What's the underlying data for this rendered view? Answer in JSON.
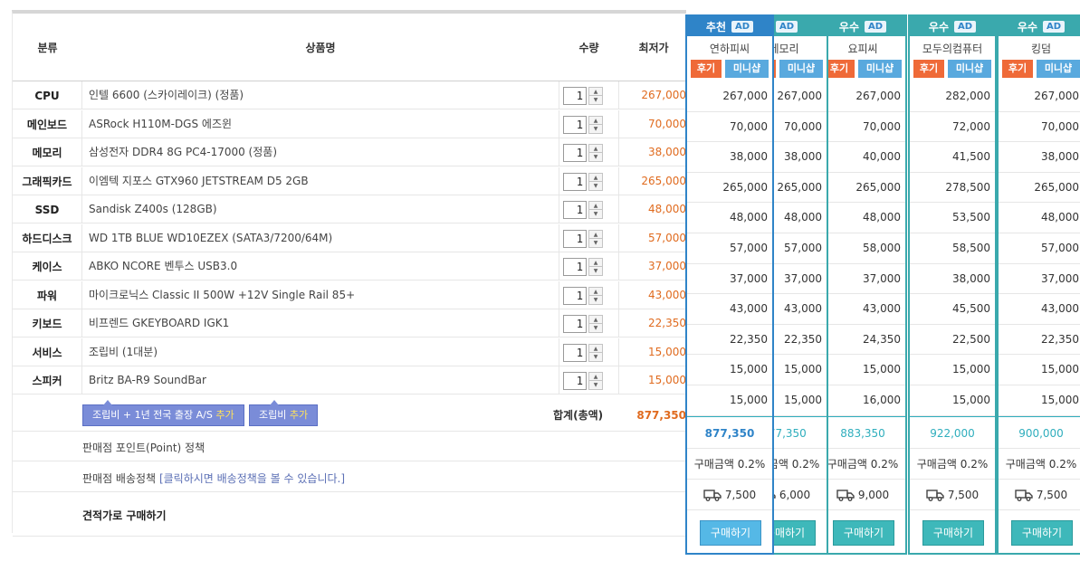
{
  "table": {
    "headers": {
      "category": "분류",
      "product": "상품명",
      "qty": "수량",
      "lowest": "최저가"
    },
    "rows": [
      {
        "category": "CPU",
        "product": "인텔 6600 (스카이레이크) (정품)",
        "qty": "1",
        "price": "267,000"
      },
      {
        "category": "메인보드",
        "product": "ASRock H110M-DGS 에즈윈",
        "qty": "1",
        "price": "70,000"
      },
      {
        "category": "메모리",
        "product": "삼성전자 DDR4 8G PC4-17000 (정품)",
        "qty": "1",
        "price": "38,000"
      },
      {
        "category": "그래픽카드",
        "product": "이엠텍 지포스 GTX960 JETSTREAM D5 2GB",
        "qty": "1",
        "price": "265,000"
      },
      {
        "category": "SSD",
        "product": "Sandisk Z400s (128GB)",
        "qty": "1",
        "price": "48,000"
      },
      {
        "category": "하드디스크",
        "product": "WD 1TB BLUE WD10EZEX (SATA3/7200/64M)",
        "qty": "1",
        "price": "57,000"
      },
      {
        "category": "케이스",
        "product": "ABKO NCORE 벤투스 USB3.0",
        "qty": "1",
        "price": "37,000"
      },
      {
        "category": "파워",
        "product": "마이크로닉스 Classic II 500W +12V Single Rail 85+",
        "qty": "1",
        "price": "43,000"
      },
      {
        "category": "키보드",
        "product": "비프렌드 GKEYBOARD IGK1",
        "qty": "1",
        "price": "22,350"
      },
      {
        "category": "서비스",
        "product": "조립비 (1대분)",
        "qty": "1",
        "price": "15,000"
      },
      {
        "category": "스피커",
        "product": "Britz BA-R9 SoundBar",
        "qty": "1",
        "price": "15,000"
      }
    ],
    "add_assembly_as": {
      "prefix": "조립비 + 1년 전국 출장 A/S ",
      "action": "추가"
    },
    "add_assembly": {
      "prefix": "조립비 ",
      "action": "추가"
    },
    "sum_label": "합계(총액)",
    "sum_value": "877,350",
    "point_policy": "판매점 포인트(Point) 정책",
    "shipping_policy": "판매점 배송정책",
    "shipping_policy_link": "[클릭하시면 배송정책을 볼 수 있습니다.]",
    "buy_at_estimate": "견적가로 구매하기"
  },
  "stores": [
    {
      "badge": "추천",
      "ad": "AD",
      "name": "연하피씨",
      "review": "후기",
      "minishop": "미니샵",
      "prices": [
        "267,000",
        "70,000",
        "38,000",
        "265,000",
        "48,000",
        "57,000",
        "37,000",
        "43,000",
        "22,350",
        "15,000",
        "15,000"
      ],
      "total": "877,350",
      "point": "구매금액 0.2%",
      "shipping": "7,500",
      "buy": "구매하기",
      "selected": true
    },
    {
      "badge": "",
      "ad": "AD",
      "name": "메모리",
      "review": "후기",
      "minishop": "미니샵",
      "prices": [
        "267,000",
        "70,000",
        "38,000",
        "265,000",
        "48,000",
        "57,000",
        "37,000",
        "43,000",
        "22,350",
        "15,000",
        "15,000"
      ],
      "total": "877,350",
      "point": "구매금액 0.2%",
      "shipping": "6,000",
      "buy": "구매하기",
      "selected": false
    },
    {
      "badge": "우수",
      "ad": "AD",
      "name": "요피씨",
      "review": "후기",
      "minishop": "미니샵",
      "prices": [
        "267,000",
        "70,000",
        "40,000",
        "265,000",
        "48,000",
        "58,000",
        "37,000",
        "43,000",
        "24,350",
        "15,000",
        "16,000"
      ],
      "total": "883,350",
      "point": "구매금액 0.2%",
      "shipping": "9,000",
      "buy": "구매하기",
      "selected": false
    },
    {
      "badge": "우수",
      "ad": "AD",
      "name": "모두의컴퓨터",
      "review": "후기",
      "minishop": "미니샵",
      "prices": [
        "282,000",
        "72,000",
        "41,500",
        "278,500",
        "53,500",
        "58,500",
        "38,000",
        "45,500",
        "22,500",
        "15,000",
        "15,000"
      ],
      "total": "922,000",
      "point": "구매금액 0.2%",
      "shipping": "7,500",
      "buy": "구매하기",
      "selected": false
    },
    {
      "badge": "우수",
      "ad": "AD",
      "name": "킹덤",
      "review": "후기",
      "minishop": "미니샵",
      "prices": [
        "267,000",
        "70,000",
        "38,000",
        "265,000",
        "48,000",
        "57,000",
        "37,000",
        "43,000",
        "22,350",
        "15,000",
        "15,000"
      ],
      "total": "900,000",
      "point": "구매금액 0.2%",
      "shipping": "7,500",
      "buy": "구매하기",
      "selected": false
    }
  ]
}
